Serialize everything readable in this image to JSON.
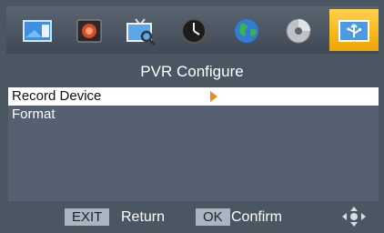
{
  "menu_title": "PVR Configure",
  "settings": [
    {
      "label": "Record Device",
      "selected": true
    },
    {
      "label": "Format",
      "selected": false
    }
  ],
  "footer": {
    "exit_key": "EXIT",
    "exit_label": "Return",
    "ok_key": "OK",
    "ok_label": "Confirm"
  },
  "icons": [
    "picture-icon",
    "media-icon",
    "tv-search-icon",
    "clock-icon",
    "globe-icon",
    "disc-icon",
    "usb-pvr-icon",
    "dpad-icon"
  ],
  "colors": {
    "active_tab": "#f0a400",
    "arrow": "#f08a1c",
    "background": "#4b5663"
  }
}
